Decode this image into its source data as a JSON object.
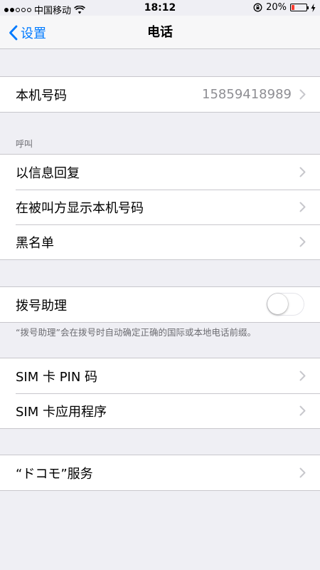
{
  "status_bar": {
    "carrier": "中国移动",
    "time": "18:12",
    "battery_percent": "20%",
    "battery_level": 0.2,
    "signal_dots_filled": 2,
    "signal_dots_total": 5
  },
  "nav": {
    "back_label": "设置",
    "title": "电话"
  },
  "my_number": {
    "label": "本机号码",
    "value": "15859418989"
  },
  "calls_section": {
    "header": "呼叫",
    "items": [
      {
        "label": "以信息回复"
      },
      {
        "label": "在被叫方显示本机号码"
      },
      {
        "label": "黑名单"
      }
    ]
  },
  "dial_assist": {
    "label": "拨号助理",
    "enabled": false,
    "footer": "“拨号助理”会在拨号时自动确定正确的国际或本地电话前缀。"
  },
  "sim_section": {
    "items": [
      {
        "label": "SIM 卡 PIN 码"
      },
      {
        "label": "SIM 卡应用程序"
      }
    ]
  },
  "carrier_services": {
    "label": "“ドコモ”服务"
  },
  "colors": {
    "accent": "#007aff",
    "background": "#efeff4",
    "battery_low": "#ff3b30"
  }
}
